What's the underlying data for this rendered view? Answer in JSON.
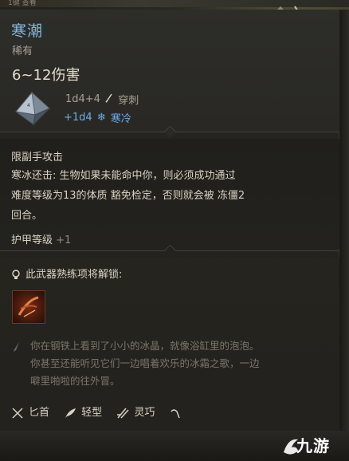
{
  "top_strip_text": "1键 查看",
  "item": {
    "name": "寒潮",
    "rarity": "稀有",
    "damage": "6~12伤害",
    "dice_primary": "1d4+4",
    "damage_type_primary": "穿刺",
    "dice_bonus": "+1d4",
    "damage_type_bonus": "寒冷"
  },
  "attack": {
    "type": "限副手攻击",
    "passive_name": "寒冰还击:",
    "passive_text_1": "生物如果未能命中你，则必须成功通过",
    "passive_text_2": "难度等级为13的体质",
    "passive_save": "豁免检定",
    "passive_text_3": "，否则就会被",
    "passive_condition": "冻僵2",
    "passive_text_4": "回合。",
    "armor_label": "护甲等级",
    "armor_value": "+1"
  },
  "proficiency": {
    "unlock_text": "此武器熟练项将解锁:"
  },
  "flavor": {
    "line1": "你在钢铁上看到了小小的冰晶，就像浴缸里的泡泡。",
    "line2": "你甚至还能听见它们一边唱着欢乐的冰霜之歌，一边",
    "line3": "噼里啪啦的往外冒。"
  },
  "properties": [
    {
      "label": "匕首",
      "icon": "dagger-icon"
    },
    {
      "label": "轻型",
      "icon": "feather-icon"
    },
    {
      "label": "灵巧",
      "icon": "finesse-icon"
    },
    {
      "label": "",
      "icon": "throw-icon"
    }
  ],
  "watermark": "九游",
  "colors": {
    "title": "#86b5e0",
    "cold": "#6aaee8",
    "body_text": "#d9d2c2",
    "muted": "#a8a194",
    "flavor": "#7b766b"
  }
}
